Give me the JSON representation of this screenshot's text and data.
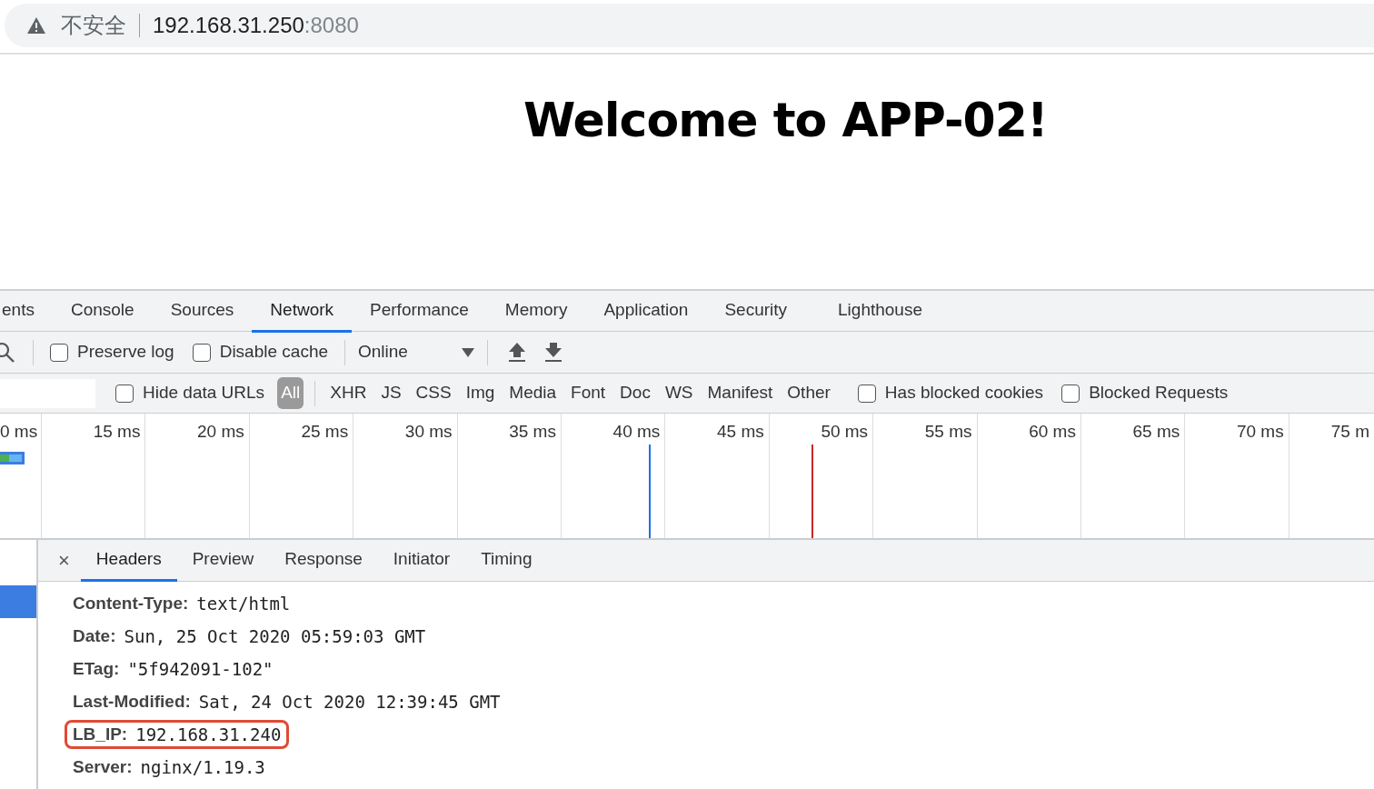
{
  "address_bar": {
    "security_label": "不安全",
    "url_host": "192.168.31.250",
    "url_port": ":8080"
  },
  "page": {
    "heading": "Welcome to APP-02!"
  },
  "devtools": {
    "tabs": [
      {
        "label": "ents",
        "selected": false
      },
      {
        "label": "Console",
        "selected": false
      },
      {
        "label": "Sources",
        "selected": false
      },
      {
        "label": "Network",
        "selected": true
      },
      {
        "label": "Performance",
        "selected": false
      },
      {
        "label": "Memory",
        "selected": false
      },
      {
        "label": "Application",
        "selected": false
      },
      {
        "label": "Security",
        "selected": false
      },
      {
        "label": "Lighthouse",
        "selected": false
      }
    ],
    "toolbar": {
      "checkboxes": [
        {
          "label": "Preserve log",
          "checked": false
        },
        {
          "label": "Disable cache",
          "checked": false
        }
      ],
      "throttling": "Online"
    },
    "filter_bar": {
      "hide_data_urls": {
        "label": "Hide data URLs",
        "checked": false
      },
      "types": [
        {
          "label": "All",
          "selected": true
        },
        {
          "label": "XHR",
          "selected": false
        },
        {
          "label": "JS",
          "selected": false
        },
        {
          "label": "CSS",
          "selected": false
        },
        {
          "label": "Img",
          "selected": false
        },
        {
          "label": "Media",
          "selected": false
        },
        {
          "label": "Font",
          "selected": false
        },
        {
          "label": "Doc",
          "selected": false
        },
        {
          "label": "WS",
          "selected": false
        },
        {
          "label": "Manifest",
          "selected": false
        },
        {
          "label": "Other",
          "selected": false
        }
      ],
      "checkboxes": [
        {
          "label": "Has blocked cookies",
          "checked": false
        },
        {
          "label": "Blocked Requests",
          "checked": false
        }
      ]
    },
    "timeline": {
      "ticks": [
        "0 ms",
        "15 ms",
        "20 ms",
        "25 ms",
        "30 ms",
        "35 ms",
        "40 ms",
        "45 ms",
        "50 ms",
        "55 ms",
        "60 ms",
        "65 ms",
        "70 ms",
        "75 m"
      ]
    },
    "detail": {
      "close": "×",
      "tabs": [
        {
          "label": "Headers",
          "selected": true
        },
        {
          "label": "Preview",
          "selected": false
        },
        {
          "label": "Response",
          "selected": false
        },
        {
          "label": "Initiator",
          "selected": false
        },
        {
          "label": "Timing",
          "selected": false
        }
      ],
      "headers": [
        {
          "name": "Content-Type:",
          "value": "text/html",
          "highlighted": false
        },
        {
          "name": "Date:",
          "value": "Sun, 25 Oct 2020 05:59:03 GMT",
          "highlighted": false
        },
        {
          "name": "ETag:",
          "value": "\"5f942091-102\"",
          "highlighted": false
        },
        {
          "name": "Last-Modified:",
          "value": "Sat, 24 Oct 2020 12:39:45 GMT",
          "highlighted": false
        },
        {
          "name": "LB_IP:",
          "value": "192.168.31.240",
          "highlighted": true
        },
        {
          "name": "Server:",
          "value": "nginx/1.19.3",
          "highlighted": false
        }
      ]
    }
  }
}
